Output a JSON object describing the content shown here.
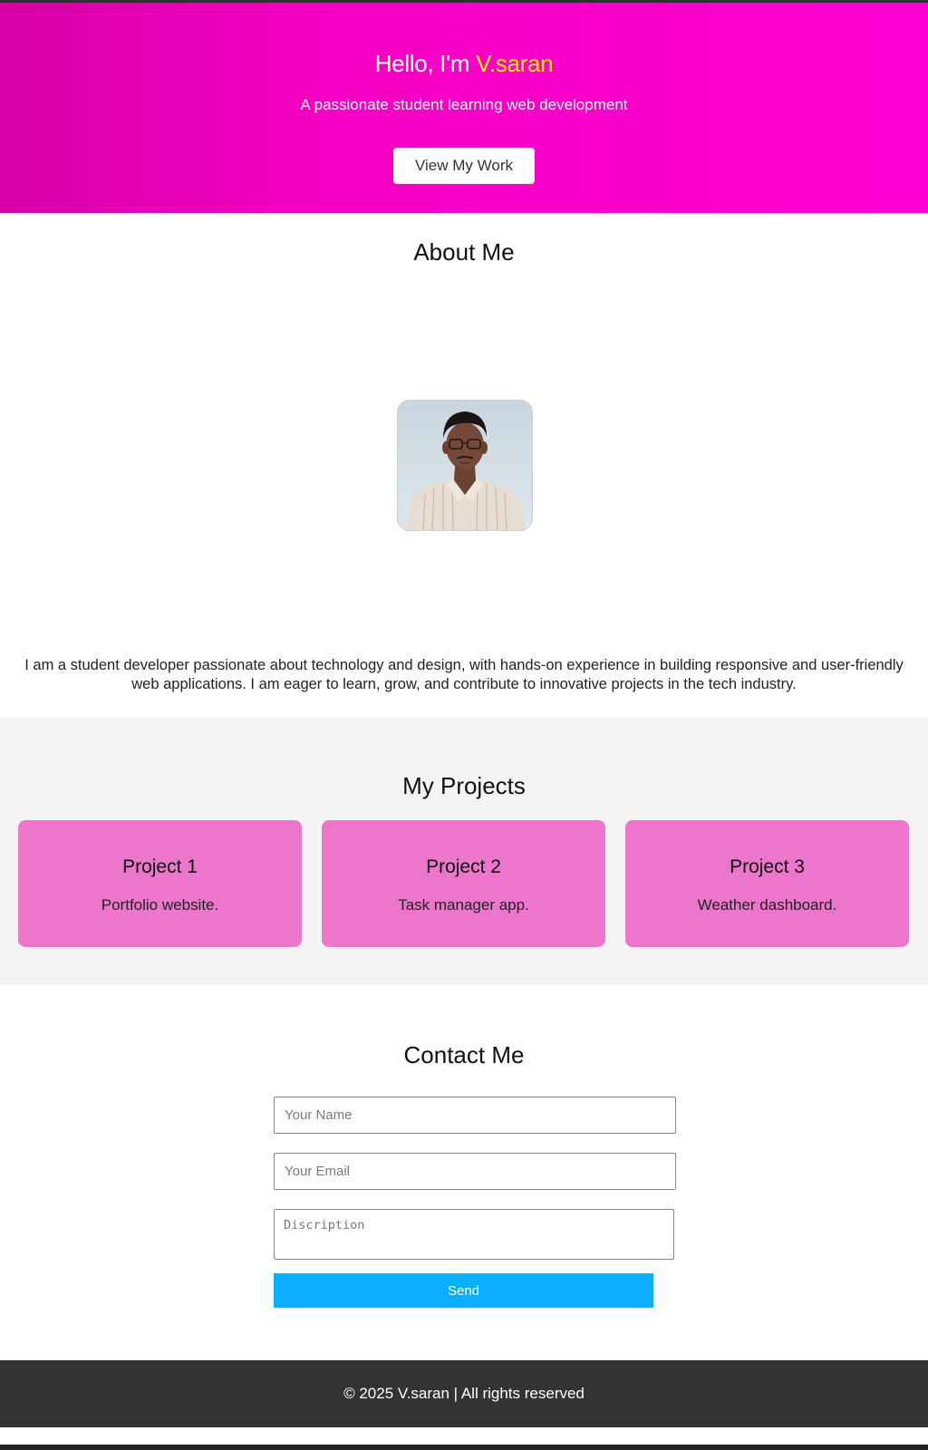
{
  "hero": {
    "greeting": "Hello, I'm ",
    "name": "V.saran",
    "subtitle": "A passionate student learning web development",
    "cta_label": "View My Work"
  },
  "about": {
    "title": "About Me",
    "bio": "I am a student developer passionate about technology and design, with hands-on experience in building responsive and user-friendly web applications. I am eager to learn, grow, and contribute to innovative projects in the tech industry."
  },
  "projects": {
    "title": "My Projects",
    "items": [
      {
        "title": "Project 1",
        "description": "Portfolio website."
      },
      {
        "title": "Project 2",
        "description": "Task manager app."
      },
      {
        "title": "Project 3",
        "description": "Weather dashboard."
      }
    ]
  },
  "contact": {
    "title": "Contact Me",
    "name_placeholder": "Your Name",
    "email_placeholder": "Your Email",
    "description_placeholder": "Discription",
    "send_label": "Send"
  },
  "footer": {
    "text": "© 2025 V.saran | All rights reserved"
  },
  "colors": {
    "hero_gradient_start": "#d600a6",
    "hero_gradient_end": "#ff00d2",
    "name_highlight": "#ffee00",
    "card_background": "#ec76cb",
    "send_button": "#0aaefc",
    "footer_background": "#333333"
  }
}
